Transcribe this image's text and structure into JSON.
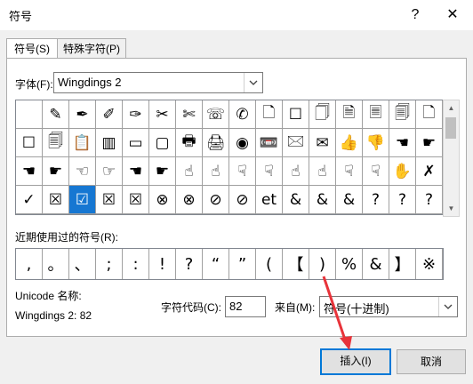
{
  "title": "符号",
  "title_buttons": {
    "help": "?",
    "close": "✕"
  },
  "tabs": [
    {
      "label": "符号(S)",
      "active": true
    },
    {
      "label": "特殊字符(P)",
      "active": false
    }
  ],
  "font": {
    "label": "字体(F):",
    "value": "Wingdings 2"
  },
  "symbols": [
    "",
    "✎",
    "✒",
    "✐",
    "✑",
    "✂",
    "✄",
    "☏",
    "✆",
    "🗋",
    "☐",
    "🗍",
    "🗎",
    "🗏",
    "🗐",
    "🗋",
    "☐",
    "🗐",
    "📋",
    "▥",
    "▭",
    "▢",
    "🖶",
    "🖨",
    "◉",
    "📼",
    "🖂",
    "✉",
    "👍",
    "👎",
    "☚",
    "☛",
    "☚",
    "☛",
    "☜",
    "☞",
    "☚",
    "☛",
    "☝",
    "☝",
    "☟",
    "☟",
    "☝",
    "☝",
    "☟",
    "☟",
    "✋",
    "✗",
    "✓",
    "☒",
    "☑",
    "☒",
    "☒",
    "⊗",
    "⊗",
    "⊘",
    "⊘",
    "et",
    "&",
    "&",
    "&",
    "?",
    "?",
    "?"
  ],
  "selected_index": 50,
  "recent": {
    "label": "近期使用过的符号(R):",
    "symbols": [
      ",",
      "。",
      "、",
      ";",
      ":",
      "!",
      "?",
      "“",
      "”",
      "(",
      "【",
      ")",
      "%",
      "&",
      "】",
      "※"
    ]
  },
  "unicode_name": {
    "label": "Unicode 名称:",
    "value": "Wingdings 2: 82"
  },
  "char_code": {
    "label": "字符代码(C):",
    "value": "82"
  },
  "from": {
    "label": "来自(M):",
    "value": "符号(十进制)"
  },
  "buttons": {
    "insert": "插入(I)",
    "cancel": "取消"
  },
  "colors": {
    "accent": "#1677d2",
    "arrow": "#e8333a"
  }
}
